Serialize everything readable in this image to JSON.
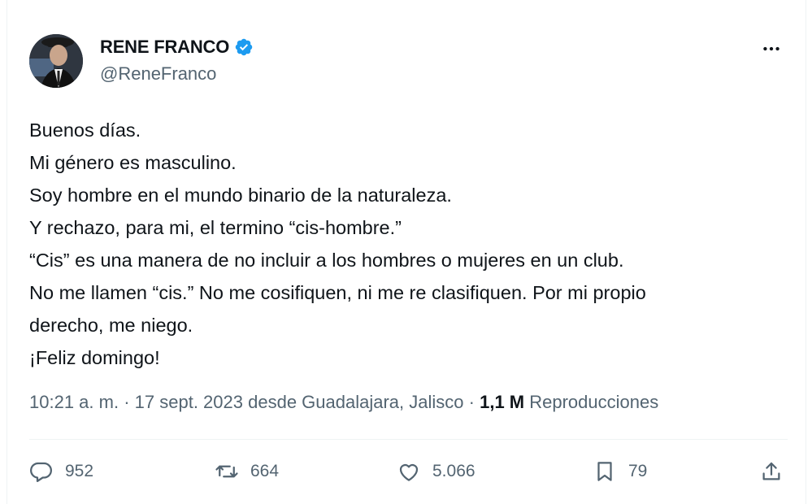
{
  "tweet": {
    "author": {
      "display_name": "RENE FRANCO",
      "handle": "@ReneFranco",
      "verified": true,
      "verified_color": "#1d9bf0"
    },
    "more_icon": "more-horizontal-icon",
    "text_lines": [
      "Buenos días.",
      "Mi género es masculino.",
      "Soy hombre en el mundo binario de la naturaleza.",
      "Y rechazo, para mi, el termino “cis-hombre.”",
      "“Cis” es una manera de no incluir a los hombres o mujeres en un club.",
      "No me llamen “cis.” No me cosifiquen, ni me re clasifiquen. Por mi propio",
      "derecho, me niego.",
      "¡Feliz domingo!"
    ],
    "meta": {
      "time": "10:21 a. m.",
      "separator": "·",
      "date": "17 sept. 2023",
      "location": "desde Guadalajara, Jalisco",
      "views_count": "1,1 M",
      "views_label": "Reproducciones"
    },
    "actions": {
      "replies": {
        "icon": "reply-icon",
        "count": "952"
      },
      "retweets": {
        "icon": "retweet-icon",
        "count": "664"
      },
      "likes": {
        "icon": "like-icon",
        "count": "5.066"
      },
      "bookmarks": {
        "icon": "bookmark-icon",
        "count": "79"
      },
      "share": {
        "icon": "share-icon"
      }
    }
  }
}
